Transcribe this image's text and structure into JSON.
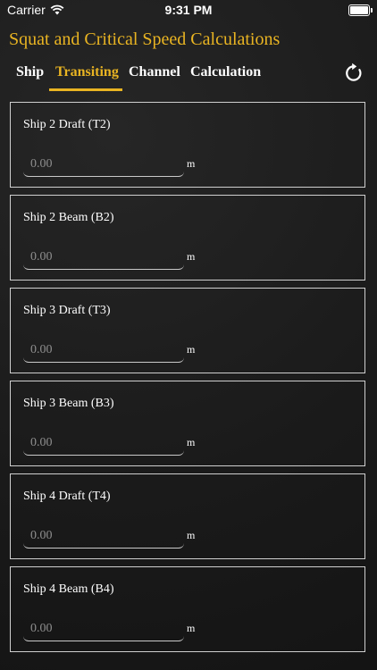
{
  "status_bar": {
    "carrier": "Carrier",
    "time": "9:31 PM"
  },
  "app_title": "Squat and Critical Speed Calculations",
  "tabs": [
    {
      "label": "Ship"
    },
    {
      "label": "Transiting"
    },
    {
      "label": "Channel"
    },
    {
      "label": "Calculation"
    }
  ],
  "active_tab": "Transiting",
  "accent_color": "#e9b422",
  "fields": [
    {
      "label": "Ship 2 Draft (T2)",
      "placeholder": "0.00",
      "unit": "m"
    },
    {
      "label": "Ship 2 Beam (B2)",
      "placeholder": "0.00",
      "unit": "m"
    },
    {
      "label": "Ship 3 Draft (T3)",
      "placeholder": "0.00",
      "unit": "m"
    },
    {
      "label": "Ship 3 Beam (B3)",
      "placeholder": "0.00",
      "unit": "m"
    },
    {
      "label": "Ship 4 Draft (T4)",
      "placeholder": "0.00",
      "unit": "m"
    },
    {
      "label": "Ship 4 Beam (B4)",
      "placeholder": "0.00",
      "unit": "m"
    }
  ]
}
